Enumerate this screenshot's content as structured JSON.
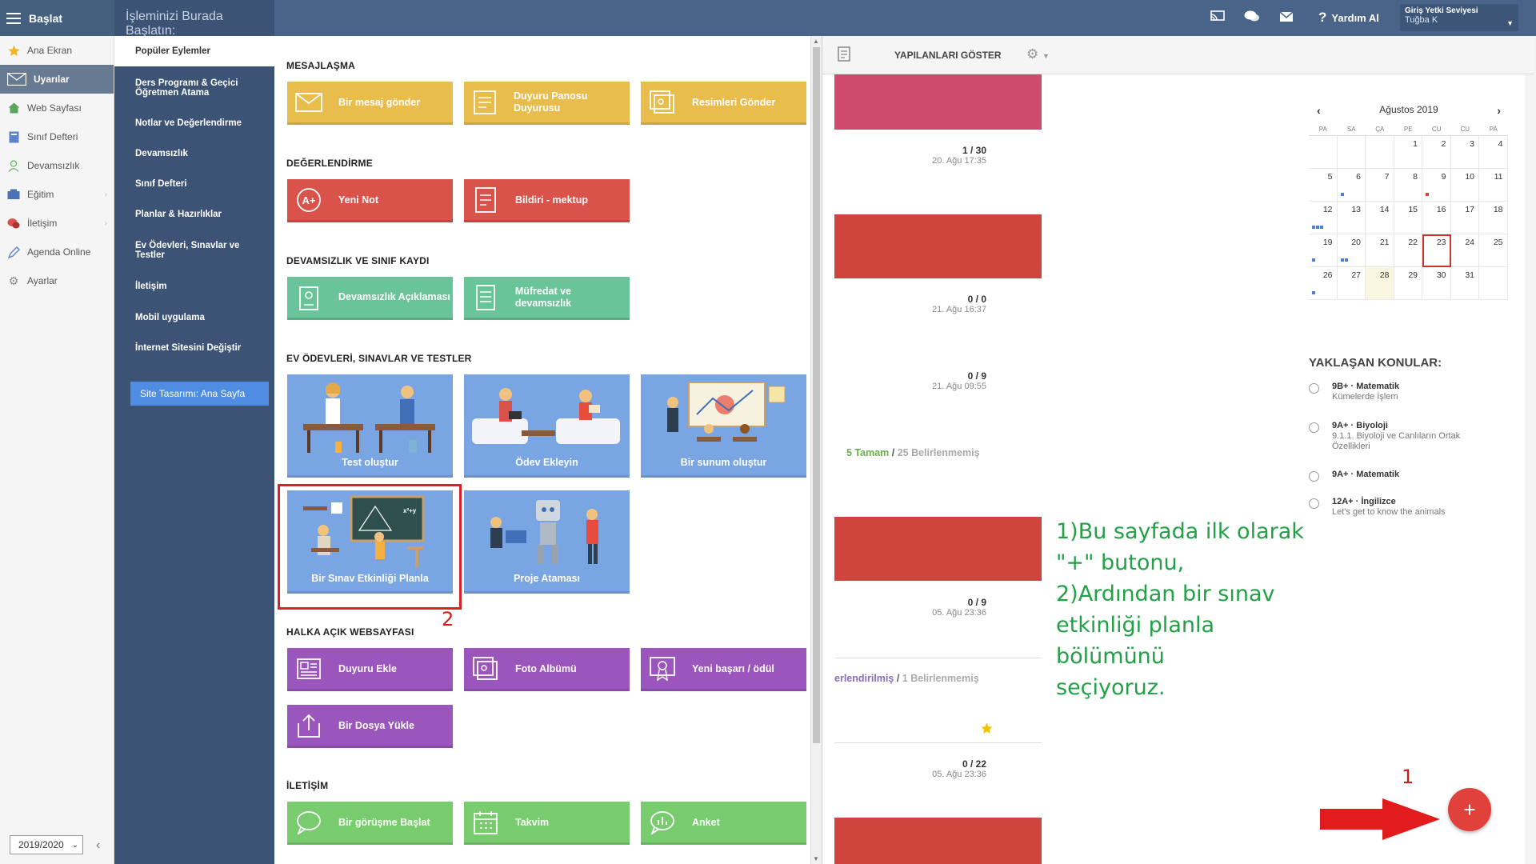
{
  "topbar": {
    "brand": "Başlat",
    "help": "Yardım Al",
    "user_role": "Giriş Yetki Seviyesi",
    "user_name": "Tuğba K"
  },
  "sidebar": {
    "items": [
      {
        "label": "Ana Ekran",
        "icon": "star-icon"
      },
      {
        "label": "Uyarılar",
        "icon": "envelope-icon"
      },
      {
        "label": "Web Sayfası",
        "icon": "home-icon"
      },
      {
        "label": "Sınıf Defteri",
        "icon": "notebook-icon"
      },
      {
        "label": "Devamsızlık",
        "icon": "person-icon"
      },
      {
        "label": "Eğitim",
        "icon": "education-icon"
      },
      {
        "label": "İletişim",
        "icon": "chat-icon"
      },
      {
        "label": "Agenda Online",
        "icon": "pencil-icon"
      },
      {
        "label": "Ayarlar",
        "icon": "gear-icon"
      }
    ],
    "year": "2019/2020"
  },
  "menu": {
    "heading": "İşleminizi Burada Başlatın:",
    "categories": [
      "Popüler Eylemler",
      "Ders Programı & Geçici Öğretmen Atama",
      "Notlar ve Değerlendirme",
      "Devamsızlık",
      "Sınıf Defteri",
      "Planlar & Hazırlıklar",
      "Ev Ödevleri, Sınavlar ve Testler",
      "İletişim",
      "Mobil uygulama",
      "İnternet Sitesini Değiştir"
    ],
    "site_button": "Site Tasarımı: Ana Sayfa",
    "sections": {
      "messaging": {
        "title": "MESAJLAŞMA",
        "tiles": [
          "Bir mesaj gönder",
          "Duyuru Panosu Duyurusu",
          "Resimleri Gönder"
        ]
      },
      "grading": {
        "title": "DEĞERLENDİRME",
        "tiles": [
          "Yeni Not",
          "Bildiri - mektup"
        ]
      },
      "attendance": {
        "title": "DEVAMSIZLIK VE SINIF KAYDI",
        "tiles": [
          "Devamsızlık Açıklaması",
          "Müfredat ve devamsızlık"
        ]
      },
      "homework": {
        "title": "EV ÖDEVLERİ, SINAVLAR VE TESTLER",
        "tiles": [
          "Test oluştur",
          "Ödev Ekleyin",
          "Bir sunum oluştur",
          "Bir Sınav Etkinliği Planla",
          "Proje Ataması"
        ]
      },
      "public": {
        "title": "HALKA AÇIK WEBSAYFASI",
        "tiles": [
          "Duyuru Ekle",
          "Foto Albümü",
          "Yeni başarı / ödül",
          "Bir Dosya Yükle"
        ]
      },
      "communication": {
        "title": "İLETİŞİM",
        "tiles": [
          "Bir görüşme Başlat",
          "Takvim",
          "Anket"
        ]
      }
    }
  },
  "toolbar": {
    "show_label": "YAPILANLARI GÖSTER"
  },
  "list": {
    "rows": [
      {
        "frac": "1 / 30",
        "date": "20. Ağu 17:35"
      },
      {
        "frac": "0 / 0",
        "date": "21. Ağu 16:37"
      },
      {
        "frac": "0 / 9",
        "date": "21. Ağu 09:55"
      },
      {
        "frac": "0 / 9",
        "date": "05. Ağu 23:36"
      },
      {
        "frac": "0 / 22",
        "date": "05. Ağu 23:36"
      }
    ],
    "status1_done": "5 Tamam",
    "status1_sep": " / ",
    "status1_undef": "25 Belirlenmemiş",
    "status2_done": "erlendirilmiş",
    "status2_sep": " / ",
    "status2_undef": "1 Belirlenmemiş"
  },
  "calendar": {
    "month": "Ağustos 2019",
    "dows": [
      "PA",
      "SA",
      "ÇA",
      "PE",
      "CU",
      "CU",
      "PA"
    ],
    "days": [
      "",
      "",
      "",
      "1",
      "2",
      "3",
      "4",
      "5",
      "6",
      "7",
      "8",
      "9",
      "10",
      "11",
      "12",
      "13",
      "14",
      "15",
      "16",
      "17",
      "18",
      "19",
      "20",
      "21",
      "22",
      "23",
      "24",
      "25",
      "26",
      "27",
      "28",
      "29",
      "30",
      "31",
      ""
    ]
  },
  "upcoming": {
    "title": "YAKLAŞAN KONULAR:",
    "items": [
      {
        "title": "9B+ · Matematik",
        "sub": "Kümelerde İşlem"
      },
      {
        "title": "9A+ · Biyoloji",
        "sub": "9.1.1. Biyoloji ve Canlıların Ortak Özellikleri"
      },
      {
        "title": "9A+ · Matematik",
        "sub": ""
      },
      {
        "title": "12A+ · İngilizce",
        "sub": "Let's get to know the animals"
      }
    ]
  },
  "annotation": {
    "text": "1)Bu sayfada ilk olarak\n\"+\" butonu,\n2)Ardından bir sınav\netkinliği planla bölümünü\nseçiyoruz.",
    "label1": "1",
    "label2": "2"
  },
  "fab": "+",
  "colors": {
    "topbar": "#4a6489",
    "menu_dark": "#3d5376",
    "yellow": "#e9bd4c",
    "red": "#d9534b",
    "green": "#6ac49a",
    "purple": "#9b56bd",
    "light_green": "#78cc6e",
    "illustration_blue": "#7aa5e3",
    "annotation_green": "#22a046",
    "annotation_red": "#d6232a"
  }
}
